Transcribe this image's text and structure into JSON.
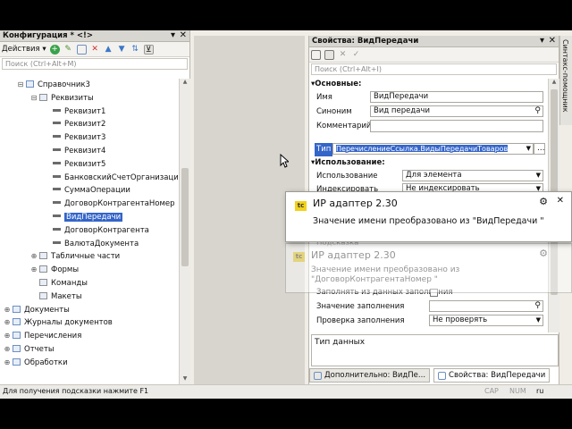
{
  "config_panel": {
    "title": "Конфигурация * <!>",
    "actions_label": "Действия",
    "search_placeholder": "Поиск (Ctrl+Alt+M)",
    "tree": [
      {
        "label": "Справочник3",
        "level": 1,
        "expanded": true
      },
      {
        "label": "Реквизиты",
        "level": 2,
        "expanded": true
      },
      {
        "label": "Реквизит1",
        "level": 3
      },
      {
        "label": "Реквизит2",
        "level": 3
      },
      {
        "label": "Реквизит3",
        "level": 3
      },
      {
        "label": "Реквизит4",
        "level": 3
      },
      {
        "label": "Реквизит5",
        "level": 3
      },
      {
        "label": "БанковскийСчетОрганизации",
        "level": 3
      },
      {
        "label": "СуммаОперации",
        "level": 3
      },
      {
        "label": "ДоговорКонтрагентаНомер",
        "level": 3
      },
      {
        "label": "ВидПередачи",
        "level": 3,
        "selected": true
      },
      {
        "label": "ДоговорКонтрагента",
        "level": 3
      },
      {
        "label": "ВалютаДокумента",
        "level": 3
      },
      {
        "label": "Табличные части",
        "level": 2,
        "collapsed": true
      },
      {
        "label": "Формы",
        "level": 2,
        "collapsed": true
      },
      {
        "label": "Команды",
        "level": 2
      },
      {
        "label": "Макеты",
        "level": 2
      },
      {
        "label": "Документы",
        "level": 0,
        "collapsed": true
      },
      {
        "label": "Журналы документов",
        "level": 0,
        "collapsed": true
      },
      {
        "label": "Перечисления",
        "level": 0,
        "collapsed": true
      },
      {
        "label": "Отчеты",
        "level": 0,
        "collapsed": true
      },
      {
        "label": "Обработки",
        "level": 0,
        "collapsed": true
      }
    ]
  },
  "props_panel": {
    "title": "Свойства: ВидПередачи",
    "search_placeholder": "Поиск (Ctrl+Alt+I)",
    "section_main": "Основные:",
    "name_label": "Имя",
    "name_value": "ВидПередачи",
    "synonym_label": "Синоним",
    "synonym_value": "Вид передачи",
    "comment_label": "Комментарий",
    "type_label": "Тип",
    "type_value": "ПеречислениеСсылка.ВидыПередачиТоваров",
    "section_usage": "Использование:",
    "usage_label": "Использование",
    "usage_value": "Для элемента",
    "index_label": "Индексировать",
    "index_value": "Не индексировать",
    "hint_label": "Подсказка",
    "fill_from_label": "Заполнять из данных заполнения",
    "fill_value_label": "Значение заполнения",
    "fill_check_label": "Проверка заполнения",
    "fill_check_value": "Не проверять",
    "description": "Тип данных",
    "side_tab": "Синтакс-помощник"
  },
  "popup1": {
    "badge": "tc",
    "title": "ИР адаптер 2.30",
    "message": "Значение имени преобразовано из \"ВидПередачи \""
  },
  "popup2": {
    "badge": "tc",
    "title": "ИР адаптер 2.30",
    "message": "Значение имени преобразовано из \"ДоговорКонтрагентаНомер \""
  },
  "bottom_tabs": [
    {
      "label": "Дополнительно: ВидПе..."
    },
    {
      "label": "Свойства: ВидПередачи",
      "active": true
    }
  ],
  "status": {
    "hint": "Для получения подсказки нажмите F1",
    "cap": "CAP",
    "num": "NUM",
    "lang": "ru"
  },
  "colors": {
    "selection": "#3465c8",
    "toolbar_add": "#3aa24a",
    "toolbar_delete": "#d03030",
    "popup_badge": "#f2d21a"
  }
}
